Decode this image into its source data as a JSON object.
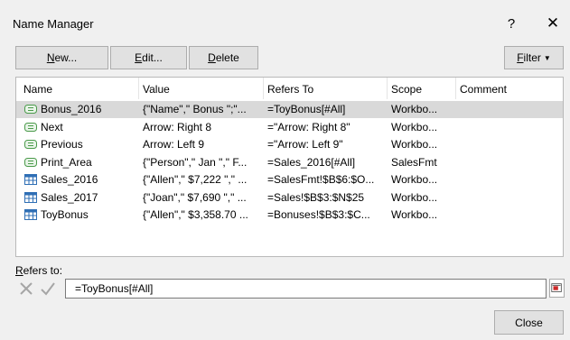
{
  "window": {
    "title": "Name Manager",
    "help_glyph": "?",
    "close_glyph": "✕"
  },
  "toolbar": {
    "new_u": "N",
    "new_rest": "ew...",
    "edit_u": "E",
    "edit_rest": "dit...",
    "delete_u": "D",
    "delete_rest": "elete",
    "filter_u": "F",
    "filter_rest": "ilter",
    "filter_caret": "▼"
  },
  "list": {
    "columns": [
      "Name",
      "Value",
      "Refers To",
      "Scope",
      "Comment"
    ],
    "rows": [
      {
        "icon": "named-range-icon",
        "name": "Bonus_2016",
        "value": "{\"Name\",\" Bonus \";\"...",
        "refers_to": "=ToyBonus[#All]",
        "scope": "Workbo...",
        "comment": "",
        "selected": true
      },
      {
        "icon": "named-range-icon",
        "name": "Next",
        "value": "Arrow: Right 8",
        "refers_to": "=\"Arrow: Right 8\"",
        "scope": "Workbo...",
        "comment": ""
      },
      {
        "icon": "named-range-icon",
        "name": "Previous",
        "value": "Arrow: Left 9",
        "refers_to": "=\"Arrow: Left 9\"",
        "scope": "Workbo...",
        "comment": ""
      },
      {
        "icon": "named-range-icon",
        "name": "Print_Area",
        "value": "{\"Person\",\" Jan \",\" F...",
        "refers_to": "=Sales_2016[#All]",
        "scope": "SalesFmt",
        "comment": ""
      },
      {
        "icon": "table-icon",
        "name": "Sales_2016",
        "value": "{\"Allen\",\" $7,222 \",\" ...",
        "refers_to": "=SalesFmt!$B$6:$O...",
        "scope": "Workbo...",
        "comment": ""
      },
      {
        "icon": "table-icon",
        "name": "Sales_2017",
        "value": "{\"Joan\",\" $7,690 \",\" ...",
        "refers_to": "=Sales!$B$3:$N$25",
        "scope": "Workbo...",
        "comment": ""
      },
      {
        "icon": "table-icon",
        "name": "ToyBonus",
        "value": "{\"Allen\",\" $3,358.70 ...",
        "refers_to": "=Bonuses!$B$3:$C...",
        "scope": "Workbo...",
        "comment": ""
      }
    ]
  },
  "refers_to": {
    "label_u": "R",
    "label_rest": "efers to:",
    "value": "=ToyBonus[#All]"
  },
  "footer": {
    "close_label": "Close"
  },
  "colors": {
    "selected_row": "#d9d9d9",
    "table_icon": "#2f6fb5",
    "range_icon": "#4a9a4a"
  }
}
